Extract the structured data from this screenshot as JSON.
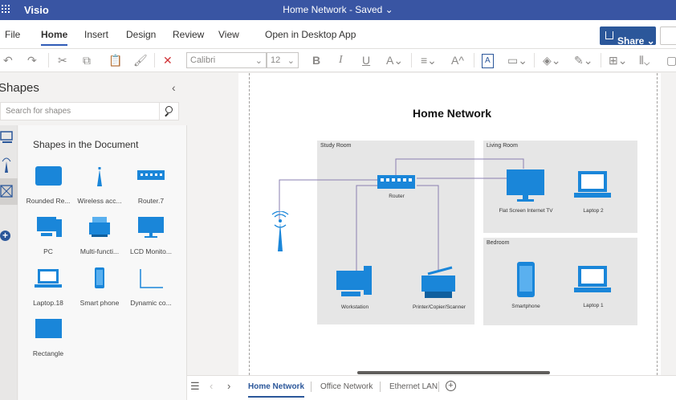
{
  "titlebar": {
    "app": "Visio",
    "document": "Home Network - Saved ⌄"
  },
  "menu": {
    "file": "File",
    "home": "Home",
    "insert": "Insert",
    "design": "Design",
    "review": "Review",
    "view": "View",
    "open_desktop": "Open in Desktop App",
    "share": "Share ⌄"
  },
  "toolbar": {
    "font": "Calibri",
    "size": "12"
  },
  "shapes_panel": {
    "title": "Shapes",
    "search_placeholder": "Search for shapes",
    "section": "Shapes in the Document",
    "items": [
      "Rounded Re...",
      "Wireless acc...",
      "Router.7",
      "PC",
      "Multi-functi...",
      "LCD Monito...",
      "Laptop.18",
      "Smart phone",
      "Dynamic co...",
      "Rectangle"
    ]
  },
  "diagram": {
    "title": "Home Network",
    "rooms": [
      "Study Room",
      "Living Room",
      "Bedroom"
    ],
    "nodes": {
      "router": "Router",
      "workstation": "Workstation",
      "printer": "Printer/Copier/Scanner",
      "tv": "Flat Screen Internet TV",
      "laptop2": "Laptop 2",
      "smartphone": "Smartphone",
      "laptop1": "Laptop 1"
    }
  },
  "sheets": [
    "Home Network",
    "Office Network",
    "Ethernet LAN"
  ],
  "colors": {
    "titlebar": "#3955a3",
    "accent": "#2b579a",
    "shape_blue": "#1a86d9"
  }
}
